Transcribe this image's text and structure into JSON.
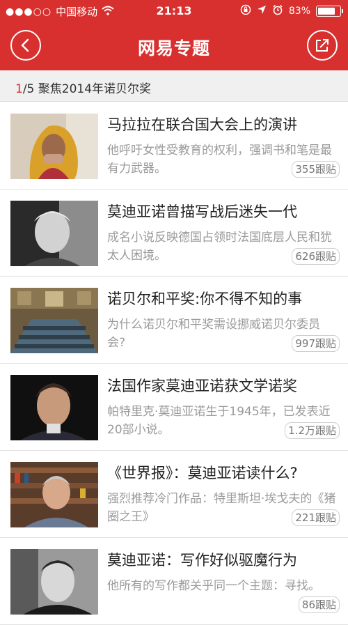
{
  "status": {
    "carrier": "中国移动",
    "time": "21:13",
    "battery": "83%",
    "battery_level": 0.83
  },
  "header": {
    "title": "网易专题"
  },
  "subbar": {
    "current": "1",
    "total": "/5",
    "label": "聚焦2014年诺贝尔奖"
  },
  "items": [
    {
      "title": "马拉拉在联合国大会上的演讲",
      "desc": "他呼吁女性受教育的权利，强调书和笔是最有力武器。",
      "count": "355跟贴"
    },
    {
      "title": "莫迪亚诺曾描写战后迷失一代",
      "desc": "成名小说反映德国占领时法国底层人民和犹太人困境。",
      "count": "626跟贴"
    },
    {
      "title": "诺贝尔和平奖:你不得不知的事",
      "desc": "为什么诺贝尔和平奖需设挪威诺贝尔委员会?",
      "count": "997跟贴"
    },
    {
      "title": "法国作家莫迪亚诺获文学诺奖",
      "desc": "帕特里克·莫迪亚诺生于1945年，已发表近20部小说。",
      "count": "1.2万跟贴"
    },
    {
      "title": "《世界报》：莫迪亚诺读什么?",
      "desc": "强烈推荐冷门作品：特里斯坦·埃戈夫的《猪圈之王》",
      "count": "221跟贴"
    },
    {
      "title": "莫迪亚诺：写作好似驱魔行为",
      "desc": "他所有的写作都关乎同一个主题：寻找。",
      "count": "86跟贴"
    }
  ]
}
